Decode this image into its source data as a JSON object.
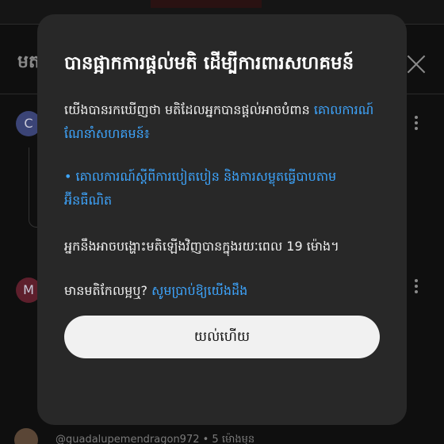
{
  "background": {
    "panel_title": "មត",
    "comments": [
      {
        "avatar_letter": "C",
        "avatar_color": "#3b4476"
      },
      {
        "avatar_letter": "M",
        "avatar_color": "#5e1f2c"
      }
    ],
    "bottom_text": "@guadalupemendragon972 • 5 ម៉ោងមុន"
  },
  "dialog": {
    "title": "បានផ្អាកការផ្ដល់មតិ ដើម្បីការពារសហគមន៍",
    "intro_text": "យើងបានរកឃើញថា មតិដែលអ្នកបានផ្ដល់អាចបំពាន",
    "intro_link": "គោលការណ៍ណែនាំសហគមន៍",
    "intro_suffix": "៖",
    "bullet_link": "• គោលការណ៍ស្ដីពីការបៀតបៀន និងការសម្លុតធ្វើបាបតាមអ៊ីនធឺណិត",
    "time_text": "អ្នកនឹងអាចបង្ហោះមតិឡើងវិញបានក្នុងរយៈពេល 19 ម៉ោង។",
    "feedback_text": "មានមតិកែលម្អឬ?",
    "feedback_link": "សូមប្រាប់ឱ្យយើងដឹង",
    "ok_button": "យល់ហើយ"
  },
  "colors": {
    "dialog_bg": "#282828",
    "link": "#3ea6ff",
    "button_bg": "#f1f1f1",
    "page_bg": "#0f0f0f"
  }
}
